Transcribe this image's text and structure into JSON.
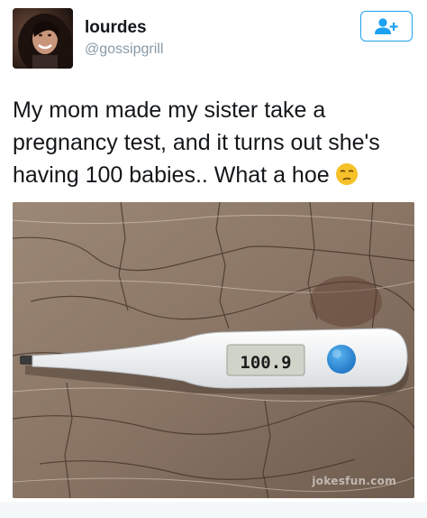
{
  "tweet": {
    "user": {
      "display_name": "lourdes",
      "handle": "@gossipgrill",
      "avatar_icon": "profile-photo"
    },
    "follow_button": {
      "icon": "follow-user-plus-icon",
      "accent": "#1da1f2"
    },
    "text": "My mom made my sister take a pregnancy test, and it turns out she's having 100 babies.. What a hoe",
    "emoji": "unamused-face-emoji",
    "media": {
      "thermometer_reading": "100.9",
      "watermark": "jokesfun.com"
    }
  }
}
